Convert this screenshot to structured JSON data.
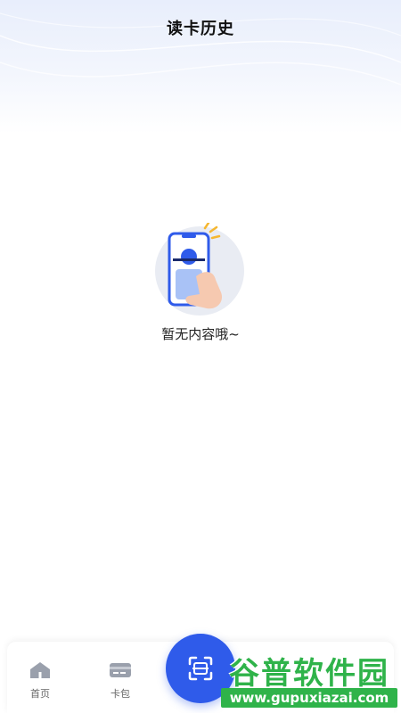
{
  "header": {
    "title": "读卡历史"
  },
  "empty_state": {
    "illustration_icon": "phone-read-card-icon",
    "message": "暂无内容哦~"
  },
  "bottom_nav": {
    "items": [
      {
        "label": "首页",
        "icon": "home-icon"
      },
      {
        "label": "卡包",
        "icon": "card-wallet-icon"
      }
    ],
    "scan_button_icon": "scan-card-icon"
  },
  "watermark": {
    "title": "谷普软件园",
    "url": "www.gupuxiazai.com"
  },
  "colors": {
    "accent": "#2f5bea",
    "header_tint": "#e8eefc",
    "watermark_green": "#2fb34a"
  }
}
